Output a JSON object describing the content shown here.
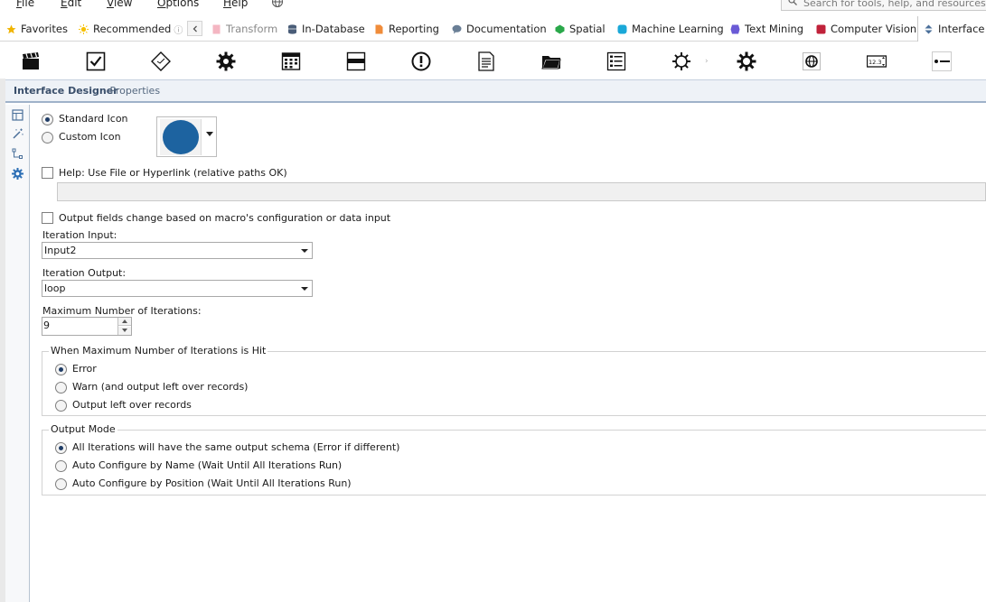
{
  "menu": {
    "items": [
      {
        "label": "File",
        "mnemonic": "F",
        "rest": "ile"
      },
      {
        "label": "Edit",
        "mnemonic": "E",
        "rest": "dit"
      },
      {
        "label": "View",
        "mnemonic": "V",
        "rest": "iew"
      },
      {
        "label": "Options",
        "mnemonic": "O",
        "rest": "ptions"
      },
      {
        "label": "Help",
        "mnemonic": "H",
        "rest": "elp"
      }
    ],
    "globe_icon": "globe-icon"
  },
  "search": {
    "placeholder": "Search for tools, help, and resources"
  },
  "tabs": [
    {
      "label": "Favorites",
      "icon": "star-icon",
      "color": "#f0b400"
    },
    {
      "label": "Recommended",
      "icon": "sun-icon",
      "color": "#f6c000",
      "info": "ⓘ"
    },
    {
      "label": "Transform",
      "icon": "doc-icon",
      "color": "#f4b6c2",
      "dim": true
    },
    {
      "label": "In-Database",
      "icon": "database-icon",
      "color": "#4a5d78"
    },
    {
      "label": "Reporting",
      "icon": "report-icon",
      "color": "#f08c3a"
    },
    {
      "label": "Documentation",
      "icon": "speech-bubble-icon",
      "color": "#6a7f96"
    },
    {
      "label": "Spatial",
      "icon": "spatial-icon",
      "color": "#2aa84a"
    },
    {
      "label": "Machine Learning",
      "icon": "ml-icon",
      "color": "#1aa8d8"
    },
    {
      "label": "Text Mining",
      "icon": "text-mining-icon",
      "color": "#6a5ad6"
    },
    {
      "label": "Computer Vision",
      "icon": "computer-vision-icon",
      "color": "#c0223a"
    },
    {
      "label": "Interface",
      "icon": "interface-icon",
      "color": "#4a6f9a",
      "active": true
    }
  ],
  "tools": [
    "clapperboard-icon",
    "checkbox-tool-icon",
    "condition-tool-icon",
    "gear-tool-icon",
    "date-tool-icon",
    "dropdown-tool-icon",
    "error-message-icon",
    "file-browse-icon",
    "folder-browse-icon",
    "list-box-icon",
    "macro-input-icon",
    "macro-output-icon",
    "map-tool-icon",
    "numeric-updown-icon",
    "radio-button-icon"
  ],
  "panel": {
    "title": "Interface Designer",
    "subtitle": "- Properties",
    "side_icons": [
      "layout-icon",
      "wand-icon",
      "tree-icon",
      "gear-icon"
    ]
  },
  "form": {
    "icon_choice": {
      "standard_label": "Standard Icon",
      "custom_label": "Custom Icon",
      "selected": "standard",
      "swatch_color": "#1d63a0"
    },
    "help": {
      "label": "Help: Use File or Hyperlink (relative paths OK)",
      "checked": false,
      "value": ""
    },
    "output_fields": {
      "label": "Output fields change based on macro's configuration or data input",
      "checked": false
    },
    "iteration_input": {
      "label": "Iteration Input:",
      "value": "Input2"
    },
    "iteration_output": {
      "label": "Iteration Output:",
      "value": "loop"
    },
    "max_iterations": {
      "label": "Maximum Number of Iterations:",
      "value": "9"
    },
    "max_hit_group": {
      "legend": "When Maximum Number of Iterations is Hit",
      "options": [
        {
          "label": "Error",
          "selected": true
        },
        {
          "label": "Warn (and output left over records)",
          "selected": false
        },
        {
          "label": "Output left over records",
          "selected": false
        }
      ]
    },
    "output_mode_group": {
      "legend": "Output Mode",
      "options": [
        {
          "label": "All Iterations will have the same output schema (Error if different)",
          "selected": true
        },
        {
          "label": "Auto Configure by Name (Wait Until All Iterations Run)",
          "selected": false
        },
        {
          "label": "Auto Configure by Position (Wait Until All Iterations Run)",
          "selected": false
        }
      ]
    }
  }
}
